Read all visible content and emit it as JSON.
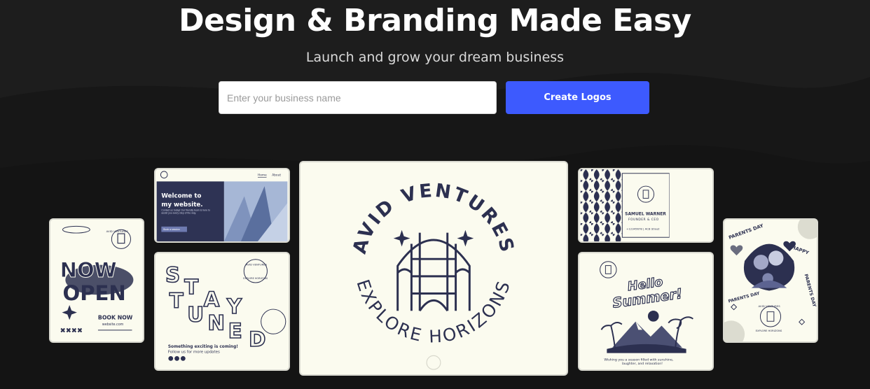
{
  "hero": {
    "title": "Design & Branding Made Easy",
    "subtitle": "Launch and grow your dream business"
  },
  "search": {
    "placeholder": "Enter your business name",
    "value": "",
    "button_label": "Create Logos"
  },
  "colors": {
    "background": "#171717",
    "accent": "#3d5afe",
    "card_bg": "#fbfbef",
    "ink": "#2c3050"
  },
  "samples": {
    "now_open": {
      "line1": "NOW",
      "line2": "OPEN",
      "book": "BOOK NOW",
      "site": "website.com",
      "marks": "✖✖✖✖",
      "badge": "AVID VENTURES"
    },
    "website": {
      "nav_home": "Home",
      "nav_about": "About",
      "heading_line1": "Welcome to",
      "heading_line2": "my website.",
      "body": "Contact us today! Our friendly team is here to assist you every step of the way.",
      "button": "Book a session"
    },
    "stay_tuned": {
      "letters": [
        "S",
        "T",
        "A",
        "Y",
        "T",
        "U",
        "N",
        "E",
        "D"
      ],
      "badge_top": "AVID VENTURES",
      "badge_bottom": "EXPLORE HORIZONS",
      "line1": "Something exciting is coming!",
      "line2": "Follow us for more updates"
    },
    "main_logo": {
      "top_text": "AVID VENTURES",
      "bottom_text": "EXPLORE HORIZONS"
    },
    "business_card": {
      "name": "SAMUEL WARNER",
      "role": "FOUNDER & CEO",
      "contact": "+12345678 | ACB Street"
    },
    "summer": {
      "line1": "Hello",
      "line2": "Summer!",
      "caption_line1": "Wishing you a season filled with sunshine,",
      "caption_line2": "laughter, and relaxation!"
    },
    "parents_day": {
      "arc_left": "PARENTS DAY",
      "arc_right": "HAPPY",
      "arc_right2": "PARENTS DAY",
      "side_text": "PARENTS DAY",
      "badge_top": "AVID VENTURES",
      "badge_bottom": "EXPLORE HORIZONS"
    }
  }
}
